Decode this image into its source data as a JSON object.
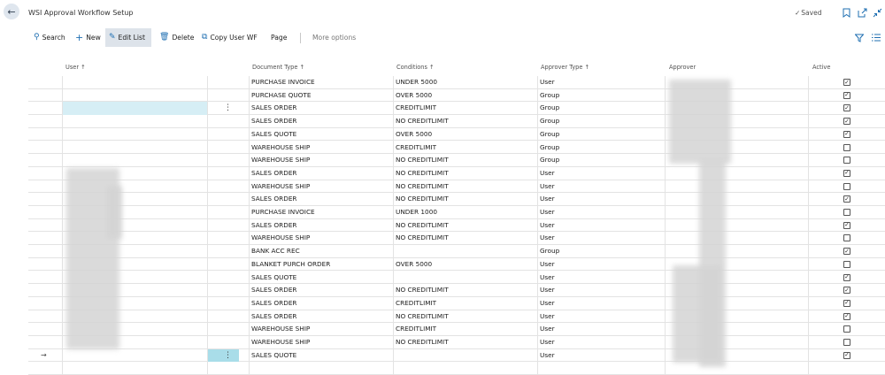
{
  "header": {
    "title": "WSI Approval Workflow Setup",
    "saved_label": "Saved"
  },
  "actions": {
    "search": "Search",
    "new": "New",
    "edit_list": "Edit List",
    "delete": "Delete",
    "copy_user_wf": "Copy User WF",
    "page": "Page",
    "more_options": "More options"
  },
  "columns": {
    "user": "User ↑",
    "document_type": "Document Type ↑",
    "conditions": "Conditions ↑",
    "approver_type": "Approver Type ↑",
    "approver": "Approver",
    "active": "Active"
  },
  "rows": [
    {
      "document_type": "PURCHASE INVOICE",
      "conditions": "UNDER 5000",
      "approver_type": "User",
      "active": true
    },
    {
      "document_type": "PURCHASE QUOTE",
      "conditions": "OVER 5000",
      "approver_type": "Group",
      "active": true
    },
    {
      "document_type": "SALES ORDER",
      "conditions": "CREDITLIMIT",
      "approver_type": "Group",
      "active": true
    },
    {
      "document_type": "SALES ORDER",
      "conditions": "NO CREDITLIMIT",
      "approver_type": "Group",
      "active": true
    },
    {
      "document_type": "SALES QUOTE",
      "conditions": "OVER 5000",
      "approver_type": "Group",
      "active": true
    },
    {
      "document_type": "WAREHOUSE SHIP",
      "conditions": "CREDITLIMIT",
      "approver_type": "Group",
      "active": false
    },
    {
      "document_type": "WAREHOUSE SHIP",
      "conditions": "NO CREDITLIMIT",
      "approver_type": "Group",
      "active": false
    },
    {
      "document_type": "SALES ORDER",
      "conditions": "NO CREDITLIMIT",
      "approver_type": "User",
      "active": true
    },
    {
      "document_type": "WAREHOUSE SHIP",
      "conditions": "NO CREDITLIMIT",
      "approver_type": "User",
      "active": false
    },
    {
      "document_type": "SALES ORDER",
      "conditions": "NO CREDITLIMIT",
      "approver_type": "User",
      "active": true
    },
    {
      "document_type": "PURCHASE INVOICE",
      "conditions": "UNDER 1000",
      "approver_type": "User",
      "active": false
    },
    {
      "document_type": "SALES ORDER",
      "conditions": "NO CREDITLIMIT",
      "approver_type": "User",
      "active": true
    },
    {
      "document_type": "WAREHOUSE SHIP",
      "conditions": "NO CREDITLIMIT",
      "approver_type": "User",
      "active": false
    },
    {
      "document_type": "BANK ACC REC",
      "conditions": "",
      "approver_type": "Group",
      "active": true
    },
    {
      "document_type": "BLANKET PURCH ORDER",
      "conditions": "OVER 5000",
      "approver_type": "User",
      "active": false
    },
    {
      "document_type": "SALES QUOTE",
      "conditions": "",
      "approver_type": "User",
      "active": true
    },
    {
      "document_type": "SALES ORDER",
      "conditions": "NO CREDITLIMIT",
      "approver_type": "User",
      "active": true
    },
    {
      "document_type": "SALES ORDER",
      "conditions": "CREDITLIMIT",
      "approver_type": "User",
      "active": true
    },
    {
      "document_type": "SALES ORDER",
      "conditions": "NO CREDITLIMIT",
      "approver_type": "User",
      "active": true
    },
    {
      "document_type": "WAREHOUSE SHIP",
      "conditions": "CREDITLIMIT",
      "approver_type": "User",
      "active": false
    },
    {
      "document_type": "WAREHOUSE SHIP",
      "conditions": "NO CREDITLIMIT",
      "approver_type": "User",
      "active": false
    },
    {
      "document_type": "SALES QUOTE",
      "conditions": "",
      "approver_type": "User",
      "active": true
    }
  ],
  "icons": {
    "back": "arrow-left-icon",
    "saved": "checkmark-icon",
    "bookmark": "bookmark-icon",
    "open_new": "open-in-new-window-icon",
    "collapse": "collapse-icon",
    "search": "search-icon",
    "new": "plus-icon",
    "edit_list": "edit-list-icon",
    "delete": "trash-icon",
    "copy": "copy-icon",
    "filter": "filter-icon",
    "list_view": "list-view-icon",
    "row_actions": "more-vertical-icon",
    "current_row": "arrow-right-icon"
  },
  "colors": {
    "accent": "#1f6fb2",
    "selected_cell": "#d6eef5",
    "new_row_cell": "#a9dde9",
    "grid_line": "#e3e3e3"
  }
}
